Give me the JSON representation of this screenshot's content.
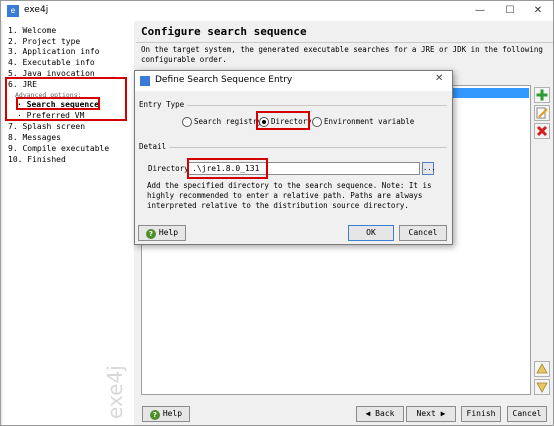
{
  "window": {
    "app_icon": "exe4j-icon",
    "title": "exe4j",
    "controls": {
      "minimize": "—",
      "maximize": "☐",
      "close": "✕"
    }
  },
  "nav": {
    "items": [
      {
        "label": "1. Welcome"
      },
      {
        "label": "2. Project type"
      },
      {
        "label": "3. Application info"
      },
      {
        "label": "4. Executable info"
      },
      {
        "label": "5. Java invocation"
      },
      {
        "label": "6. JRE"
      },
      {
        "label": "Advanced options:"
      },
      {
        "label": "· Search sequence"
      },
      {
        "label": "· Preferred VM"
      },
      {
        "label": "7. Splash screen"
      },
      {
        "label": "8. Messages"
      },
      {
        "label": "9. Compile executable"
      },
      {
        "label": "10. Finished"
      }
    ],
    "watermark": "exe4j"
  },
  "panel": {
    "title": "Configure search sequence",
    "description": "On the target system, the generated executable searches for a JRE or JDK in the following configurable order."
  },
  "footer": {
    "help": "Help",
    "back": "◀ Back",
    "next": "Next ▶",
    "finish": "Finish",
    "cancel": "Cancel"
  },
  "dialog": {
    "title": "Define Search Sequence Entry",
    "close": "✕",
    "entry_type_label": "Entry Type",
    "options": {
      "search_registry": "Search registry",
      "directory": "Directory",
      "environment_variable": "Environment variable"
    },
    "selected_option": "directory",
    "detail_label": "Detail",
    "directory_label": "Directory:",
    "directory_value": ".\\jre1.8.0_131",
    "browse": "...",
    "note": "Add the specified directory to the search sequence. Note: It is highly recommended to enter a relative path. Paths are always interpreted relative to the distribution source directory.",
    "help": "Help",
    "ok": "OK",
    "cancel": "Cancel"
  },
  "colors": {
    "highlight_box": "#d40000",
    "selection": "#3399ff",
    "help_icon": "#4f8f2a"
  }
}
